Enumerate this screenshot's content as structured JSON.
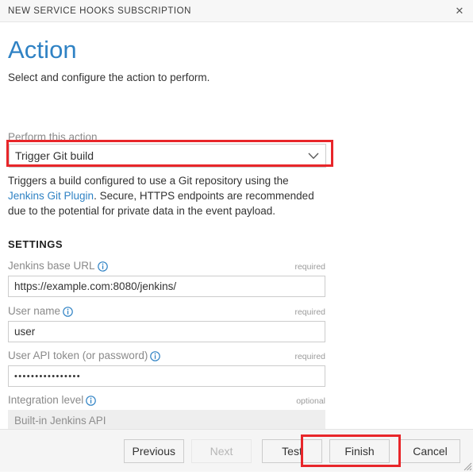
{
  "titlebar": {
    "title": "NEW SERVICE HOOKS SUBSCRIPTION",
    "close_icon": "close-icon",
    "close_glyph": "✕"
  },
  "header": {
    "title": "Action",
    "subtitle": "Select and configure the action to perform."
  },
  "action_select": {
    "label": "Perform this action",
    "value": "Trigger Git build",
    "caret_icon": "chevron-down-icon",
    "options": [
      "Trigger Git build"
    ]
  },
  "description": {
    "part1": "Triggers a build configured to use a Git repository using the ",
    "link": "Jenkins Git Plugin",
    "part2": ". Secure, HTTPS endpoints are recommended due to the potential for private data in the event payload."
  },
  "settings": {
    "heading": "SETTINGS",
    "fields": [
      {
        "label": "Jenkins base URL",
        "requirement": "required",
        "value": "https://example.com:8080/jenkins/",
        "placeholder": "",
        "type": "text",
        "disabled": false,
        "info_icon": "info-icon"
      },
      {
        "label": "User name",
        "requirement": "required",
        "value": "user",
        "placeholder": "",
        "type": "text",
        "disabled": false,
        "info_icon": "info-icon"
      },
      {
        "label": "User API token (or password)",
        "requirement": "required",
        "value": "••••••••••••••••",
        "placeholder": "",
        "type": "password",
        "disabled": false,
        "info_icon": "info-icon"
      },
      {
        "label": "Integration level",
        "requirement": "optional",
        "value": "Built-in Jenkins API",
        "placeholder": "",
        "type": "text",
        "disabled": true,
        "info_icon": "info-icon"
      }
    ]
  },
  "footer": {
    "buttons": [
      {
        "label": "Previous",
        "disabled": false
      },
      {
        "label": "Next",
        "disabled": true
      },
      {
        "label": "Test",
        "disabled": false
      },
      {
        "label": "Finish",
        "disabled": false
      },
      {
        "label": "Cancel",
        "disabled": false
      }
    ]
  },
  "highlights": {
    "dropdown_color": "#e8262a",
    "buttons_color": "#e8262a"
  }
}
